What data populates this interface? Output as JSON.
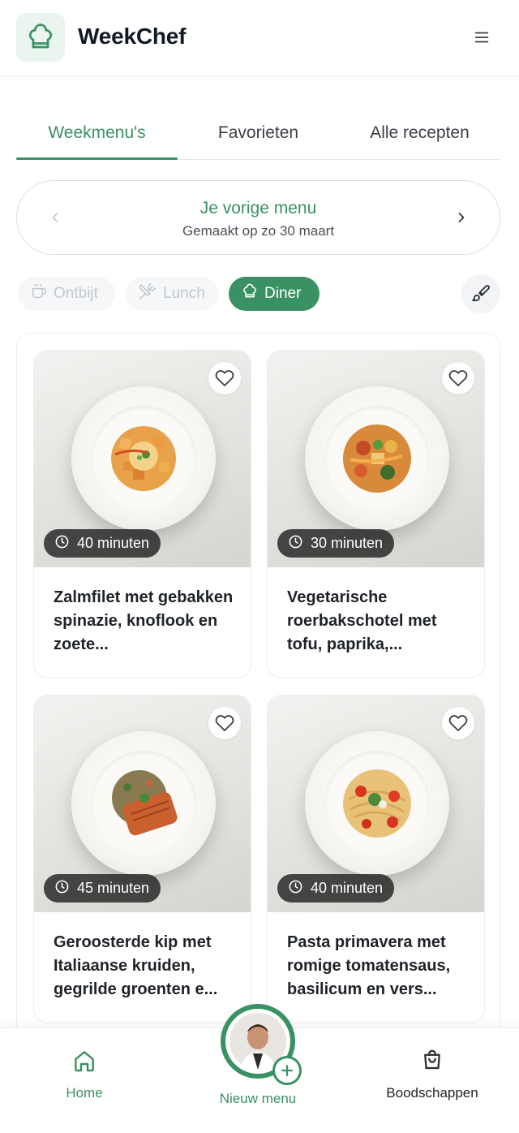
{
  "app": {
    "title": "WeekChef"
  },
  "tabs": [
    {
      "label": "Weekmenu's",
      "active": true
    },
    {
      "label": "Favorieten",
      "active": false
    },
    {
      "label": "Alle recepten",
      "active": false
    }
  ],
  "previous_menu": {
    "title": "Je vorige menu",
    "subtitle": "Gemaakt op zo 30 maart"
  },
  "meal_filters": [
    {
      "label": "Ontbijt",
      "icon": "coffee-cup-icon",
      "active": false
    },
    {
      "label": "Lunch",
      "icon": "utensils-crossed-icon",
      "active": false
    },
    {
      "label": "Diner",
      "icon": "chef-hat-icon",
      "active": true
    }
  ],
  "recipes": [
    {
      "time": "40 minuten",
      "title": "Zalmfilet met gebakken spinazie, knoflook en zoete...",
      "favorite": false
    },
    {
      "time": "30 minuten",
      "title": "Vegetarische roerbakschotel met tofu, paprika,...",
      "favorite": false
    },
    {
      "time": "45 minuten",
      "title": "Geroosterde kip met Italiaanse kruiden, gegrilde groenten e...",
      "favorite": false
    },
    {
      "time": "40 minuten",
      "title": "Pasta primavera met romige tomatensaus, basilicum en vers...",
      "favorite": false
    }
  ],
  "bottom_nav": {
    "home_label": "Home",
    "new_menu_label": "Nieuw menu",
    "shopping_label": "Boodschappen"
  },
  "colors": {
    "accent": "#3a9163",
    "accent_light": "#e9f5ee",
    "text": "#1f2328",
    "muted": "#c4c8cc"
  }
}
